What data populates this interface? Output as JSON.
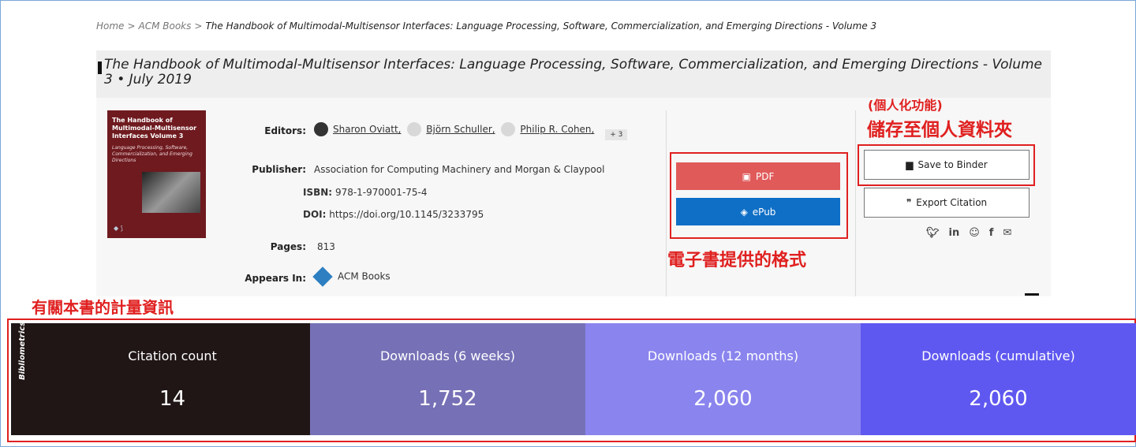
{
  "breadcrumb": {
    "home": "Home",
    "sep": ">",
    "section": "ACM Books",
    "current": "The Handbook of Multimodal-Multisensor Interfaces: Language Processing, Software, Commercialization, and Emerging Directions - Volume 3"
  },
  "title": "The Handbook of Multimodal-Multisensor Interfaces: Language Processing, Software, Commercialization, and Emerging Directions - Volume 3 • July 2019",
  "cover": {
    "title": "The Handbook of Multimodal-Multisensor Interfaces Volume 3",
    "subtitle": "Language Processing, Software, Commercialization, and Emerging Directions"
  },
  "meta": {
    "editors_label": "Editors:",
    "editors": [
      "Sharon Oviatt,",
      "Björn Schuller,",
      "Philip R. Cohen,"
    ],
    "editors_more": "+ 3",
    "publisher_label": "Publisher:",
    "publisher": "Association for Computing Machinery and Morgan & Claypool",
    "isbn_label": "ISBN:",
    "isbn": "978-1-970001-75-4",
    "doi_label": "DOI:",
    "doi": "https://doi.org/10.1145/3233795",
    "pages_label": "Pages:",
    "pages": "813",
    "appears_label": "Appears In:",
    "appears": "ACM Books"
  },
  "actions": {
    "pdf": "PDF",
    "epub": "ePub",
    "binder": "Save to Binder",
    "export": "Export Citation"
  },
  "share_icons": [
    "twitter-icon",
    "linkedin-icon",
    "reddit-icon",
    "facebook-icon",
    "email-icon"
  ],
  "annotations": {
    "personal_small": "(個人化功能)",
    "personal_big": "儲存至個人資料夾",
    "formats": "電子書提供的格式",
    "metrics": "有關本書的計量資訊"
  },
  "bibliometrics": {
    "label": "Bibliometrics",
    "items": [
      {
        "title": "Citation count",
        "value": "14",
        "color": "#201616"
      },
      {
        "title": "Downloads (6 weeks)",
        "value": "1,752",
        "color": "#7670b6"
      },
      {
        "title": "Downloads (12 months)",
        "value": "2,060",
        "color": "#8a84ee"
      },
      {
        "title": "Downloads (cumulative)",
        "value": "2,060",
        "color": "#5f58f0"
      }
    ]
  },
  "colors": {
    "annotation": "#e02020",
    "pdf": "#e05a5a",
    "epub": "#0f6fc6"
  }
}
